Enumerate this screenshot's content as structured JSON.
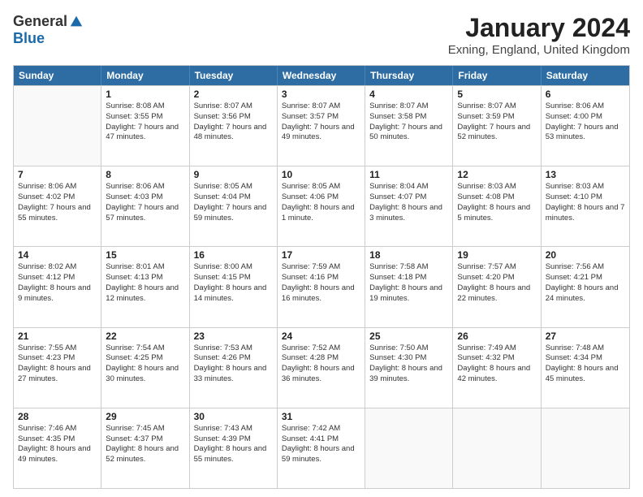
{
  "logo": {
    "general": "General",
    "blue": "Blue"
  },
  "title": "January 2024",
  "location": "Exning, England, United Kingdom",
  "weekdays": [
    "Sunday",
    "Monday",
    "Tuesday",
    "Wednesday",
    "Thursday",
    "Friday",
    "Saturday"
  ],
  "weeks": [
    [
      {
        "day": null
      },
      {
        "day": "1",
        "sunrise": "8:08 AM",
        "sunset": "3:55 PM",
        "daylight": "7 hours and 47 minutes."
      },
      {
        "day": "2",
        "sunrise": "8:07 AM",
        "sunset": "3:56 PM",
        "daylight": "7 hours and 48 minutes."
      },
      {
        "day": "3",
        "sunrise": "8:07 AM",
        "sunset": "3:57 PM",
        "daylight": "7 hours and 49 minutes."
      },
      {
        "day": "4",
        "sunrise": "8:07 AM",
        "sunset": "3:58 PM",
        "daylight": "7 hours and 50 minutes."
      },
      {
        "day": "5",
        "sunrise": "8:07 AM",
        "sunset": "3:59 PM",
        "daylight": "7 hours and 52 minutes."
      },
      {
        "day": "6",
        "sunrise": "8:06 AM",
        "sunset": "4:00 PM",
        "daylight": "7 hours and 53 minutes."
      }
    ],
    [
      {
        "day": "7",
        "sunrise": "8:06 AM",
        "sunset": "4:02 PM",
        "daylight": "7 hours and 55 minutes."
      },
      {
        "day": "8",
        "sunrise": "8:06 AM",
        "sunset": "4:03 PM",
        "daylight": "7 hours and 57 minutes."
      },
      {
        "day": "9",
        "sunrise": "8:05 AM",
        "sunset": "4:04 PM",
        "daylight": "7 hours and 59 minutes."
      },
      {
        "day": "10",
        "sunrise": "8:05 AM",
        "sunset": "4:06 PM",
        "daylight": "8 hours and 1 minute."
      },
      {
        "day": "11",
        "sunrise": "8:04 AM",
        "sunset": "4:07 PM",
        "daylight": "8 hours and 3 minutes."
      },
      {
        "day": "12",
        "sunrise": "8:03 AM",
        "sunset": "4:08 PM",
        "daylight": "8 hours and 5 minutes."
      },
      {
        "day": "13",
        "sunrise": "8:03 AM",
        "sunset": "4:10 PM",
        "daylight": "8 hours and 7 minutes."
      }
    ],
    [
      {
        "day": "14",
        "sunrise": "8:02 AM",
        "sunset": "4:12 PM",
        "daylight": "8 hours and 9 minutes."
      },
      {
        "day": "15",
        "sunrise": "8:01 AM",
        "sunset": "4:13 PM",
        "daylight": "8 hours and 12 minutes."
      },
      {
        "day": "16",
        "sunrise": "8:00 AM",
        "sunset": "4:15 PM",
        "daylight": "8 hours and 14 minutes."
      },
      {
        "day": "17",
        "sunrise": "7:59 AM",
        "sunset": "4:16 PM",
        "daylight": "8 hours and 16 minutes."
      },
      {
        "day": "18",
        "sunrise": "7:58 AM",
        "sunset": "4:18 PM",
        "daylight": "8 hours and 19 minutes."
      },
      {
        "day": "19",
        "sunrise": "7:57 AM",
        "sunset": "4:20 PM",
        "daylight": "8 hours and 22 minutes."
      },
      {
        "day": "20",
        "sunrise": "7:56 AM",
        "sunset": "4:21 PM",
        "daylight": "8 hours and 24 minutes."
      }
    ],
    [
      {
        "day": "21",
        "sunrise": "7:55 AM",
        "sunset": "4:23 PM",
        "daylight": "8 hours and 27 minutes."
      },
      {
        "day": "22",
        "sunrise": "7:54 AM",
        "sunset": "4:25 PM",
        "daylight": "8 hours and 30 minutes."
      },
      {
        "day": "23",
        "sunrise": "7:53 AM",
        "sunset": "4:26 PM",
        "daylight": "8 hours and 33 minutes."
      },
      {
        "day": "24",
        "sunrise": "7:52 AM",
        "sunset": "4:28 PM",
        "daylight": "8 hours and 36 minutes."
      },
      {
        "day": "25",
        "sunrise": "7:50 AM",
        "sunset": "4:30 PM",
        "daylight": "8 hours and 39 minutes."
      },
      {
        "day": "26",
        "sunrise": "7:49 AM",
        "sunset": "4:32 PM",
        "daylight": "8 hours and 42 minutes."
      },
      {
        "day": "27",
        "sunrise": "7:48 AM",
        "sunset": "4:34 PM",
        "daylight": "8 hours and 45 minutes."
      }
    ],
    [
      {
        "day": "28",
        "sunrise": "7:46 AM",
        "sunset": "4:35 PM",
        "daylight": "8 hours and 49 minutes."
      },
      {
        "day": "29",
        "sunrise": "7:45 AM",
        "sunset": "4:37 PM",
        "daylight": "8 hours and 52 minutes."
      },
      {
        "day": "30",
        "sunrise": "7:43 AM",
        "sunset": "4:39 PM",
        "daylight": "8 hours and 55 minutes."
      },
      {
        "day": "31",
        "sunrise": "7:42 AM",
        "sunset": "4:41 PM",
        "daylight": "8 hours and 59 minutes."
      },
      {
        "day": null
      },
      {
        "day": null
      },
      {
        "day": null
      }
    ]
  ]
}
